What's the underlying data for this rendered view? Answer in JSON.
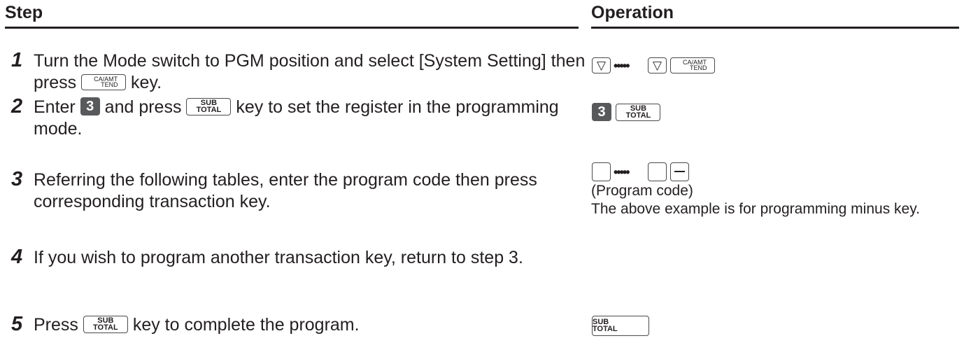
{
  "header": {
    "step": "Step",
    "operation": "Operation"
  },
  "steps": [
    {
      "num": "1",
      "a": "Turn the Mode switch to PGM position and select [System Setting] then press",
      "b": "key."
    },
    {
      "num": "2",
      "a": "Enter",
      "b": "and press",
      "c": "key to set the register in the programming mode."
    },
    {
      "num": "3",
      "a": "Referring the following tables, enter the program code then press corresponding transaction key."
    },
    {
      "num": "4",
      "a": "If you wish to program another transaction key, return to step 3."
    },
    {
      "num": "5",
      "a": "Press",
      "b": "key to complete the program."
    }
  ],
  "keys": {
    "ca_top": "CA/AMT",
    "ca_bot": "TEND",
    "sub_top": "SUB",
    "sub_bot": "TOTAL",
    "num3": "3",
    "minus": "—",
    "down": "▽",
    "dots": "•••••"
  },
  "operation": {
    "program_code": "(Program code)",
    "example_note": "The above example is for programming minus key."
  }
}
